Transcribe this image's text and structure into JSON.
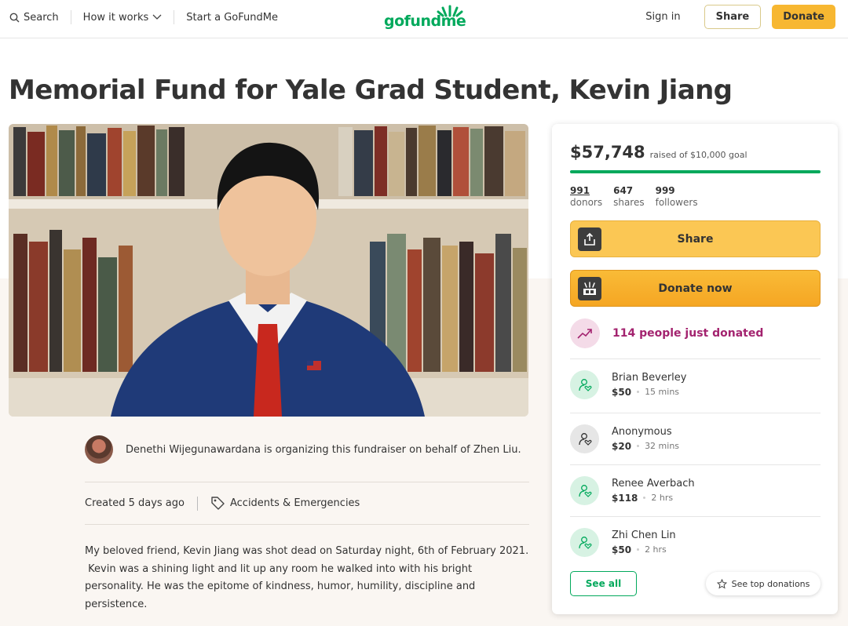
{
  "header": {
    "search_label": "Search",
    "how_it_works_label": "How it works",
    "start_label": "Start a GoFundMe",
    "logo_text": "gofundme",
    "signin_label": "Sign in",
    "share_label": "Share",
    "donate_label": "Donate"
  },
  "campaign": {
    "title": "Memorial Fund for Yale Grad Student, Kevin Jiang",
    "organizer_text": "Denethi Wijegunawardana is organizing this fundraiser on behalf of Zhen Liu.",
    "created": "Created 5 days ago",
    "category": "Accidents & Emergencies",
    "story": "My beloved friend, Kevin Jiang was shot dead on Saturday night, 6th of February 2021.\n Kevin was a shining light and lit up any room he walked into with his bright personality. He was the epitome of kindness, humor, humility, discipline and persistence."
  },
  "sidebar": {
    "amount": "$57,748",
    "goal_text": "raised of $10,000 goal",
    "progress_fraction": 1.0,
    "stats": [
      {
        "num": "991",
        "label": "donors"
      },
      {
        "num": "647",
        "label": "shares"
      },
      {
        "num": "999",
        "label": "followers"
      }
    ],
    "share_button": "Share",
    "donate_button": "Donate now",
    "trending_text": "114 people just donated",
    "donations": [
      {
        "name": "Brian Beverley",
        "amount": "$50",
        "time": "15 mins"
      },
      {
        "name": "Anonymous",
        "amount": "$20",
        "time": "32 mins"
      },
      {
        "name": "Renee Averbach",
        "amount": "$118",
        "time": "2 hrs"
      },
      {
        "name": "Zhi Chen Lin",
        "amount": "$50",
        "time": "2 hrs"
      }
    ],
    "see_all_label": "See all",
    "see_top_label": "See top donations"
  },
  "colors": {
    "brand_green": "#02a95c",
    "donate_yellow": "#f7b731",
    "trending_magenta": "#a3236f"
  }
}
